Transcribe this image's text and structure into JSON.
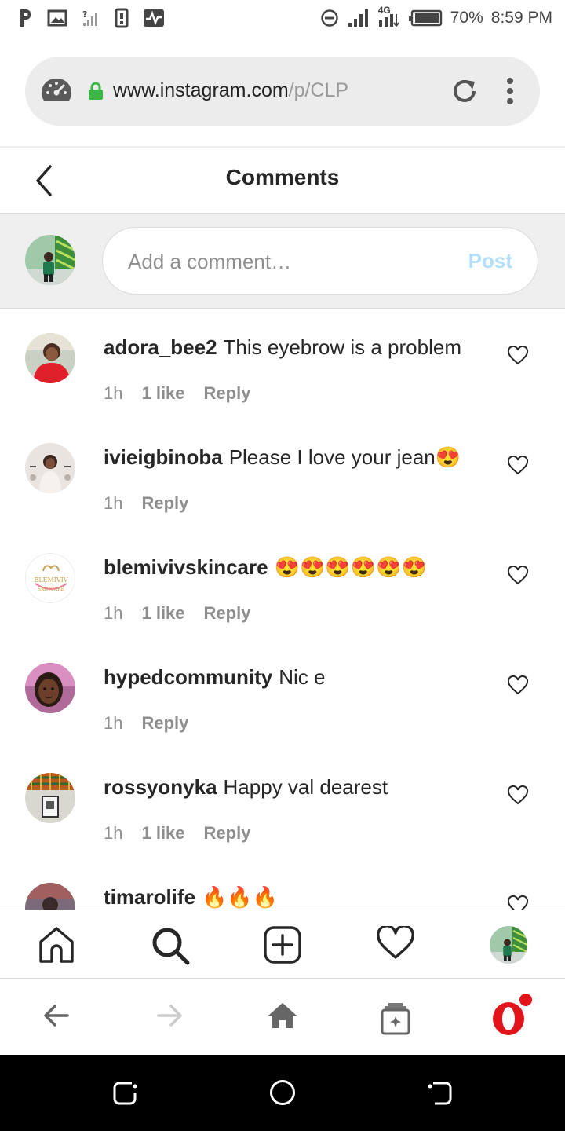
{
  "status_bar": {
    "network": "4G",
    "battery": "70%",
    "time": "8:59 PM"
  },
  "browser": {
    "url_domain": "www.instagram.com",
    "url_path": "/p/CLPgJfgDS"
  },
  "header": {
    "title": "Comments"
  },
  "composer": {
    "placeholder": "Add a comment…",
    "post_label": "Post"
  },
  "comments": [
    {
      "username": "adora_bee2",
      "text": "This eyebrow is a problem",
      "time": "1h",
      "likes": "1 like",
      "reply": "Reply"
    },
    {
      "username": "ivieigbinoba",
      "text": "Please I love your jean😍",
      "time": "1h",
      "likes": "",
      "reply": "Reply"
    },
    {
      "username": "blemivivskincare",
      "text": "😍😍😍😍😍😍",
      "time": "1h",
      "likes": "1 like",
      "reply": "Reply"
    },
    {
      "username": "hypedcommunity",
      "text": "Nic e",
      "time": "1h",
      "likes": "",
      "reply": "Reply"
    },
    {
      "username": "rossyonyka",
      "text": "Happy val dearest",
      "time": "1h",
      "likes": "1 like",
      "reply": "Reply"
    },
    {
      "username": "timarolife",
      "text": "🔥🔥🔥",
      "time": "",
      "likes": "",
      "reply": ""
    }
  ],
  "avatar_logo_text": {
    "line1": "BLEMIVIV",
    "line2": "SKINCARE"
  },
  "icons": {
    "status_left": [
      "pinterest-icon",
      "gallery-icon",
      "no-signal-icon",
      "sim-icon",
      "pulse-icon"
    ],
    "status_right": [
      "dnd-icon",
      "signal-icon",
      "4g-data-icon",
      "battery-icon"
    ],
    "address": [
      "speed-dial-icon",
      "lock-icon",
      "reload-icon",
      "overflow-menu-icon"
    ],
    "comment_like": "heart-outline-icon",
    "ig_nav": [
      "home-icon",
      "search-icon",
      "new-post-icon",
      "activity-heart-icon",
      "profile-avatar"
    ],
    "browser_nav": [
      "back-arrow-icon",
      "forward-arrow-icon",
      "home-icon",
      "tabs-icon",
      "opera-logo-icon"
    ],
    "system_nav": [
      "recents-icon",
      "home-circle-icon",
      "back-icon"
    ]
  },
  "colors": {
    "post_disabled": "#b2dffc",
    "secure_lock": "#3cb648",
    "opera_red": "#e2141b",
    "text_primary": "#262626",
    "text_secondary": "#8e8e8e"
  }
}
